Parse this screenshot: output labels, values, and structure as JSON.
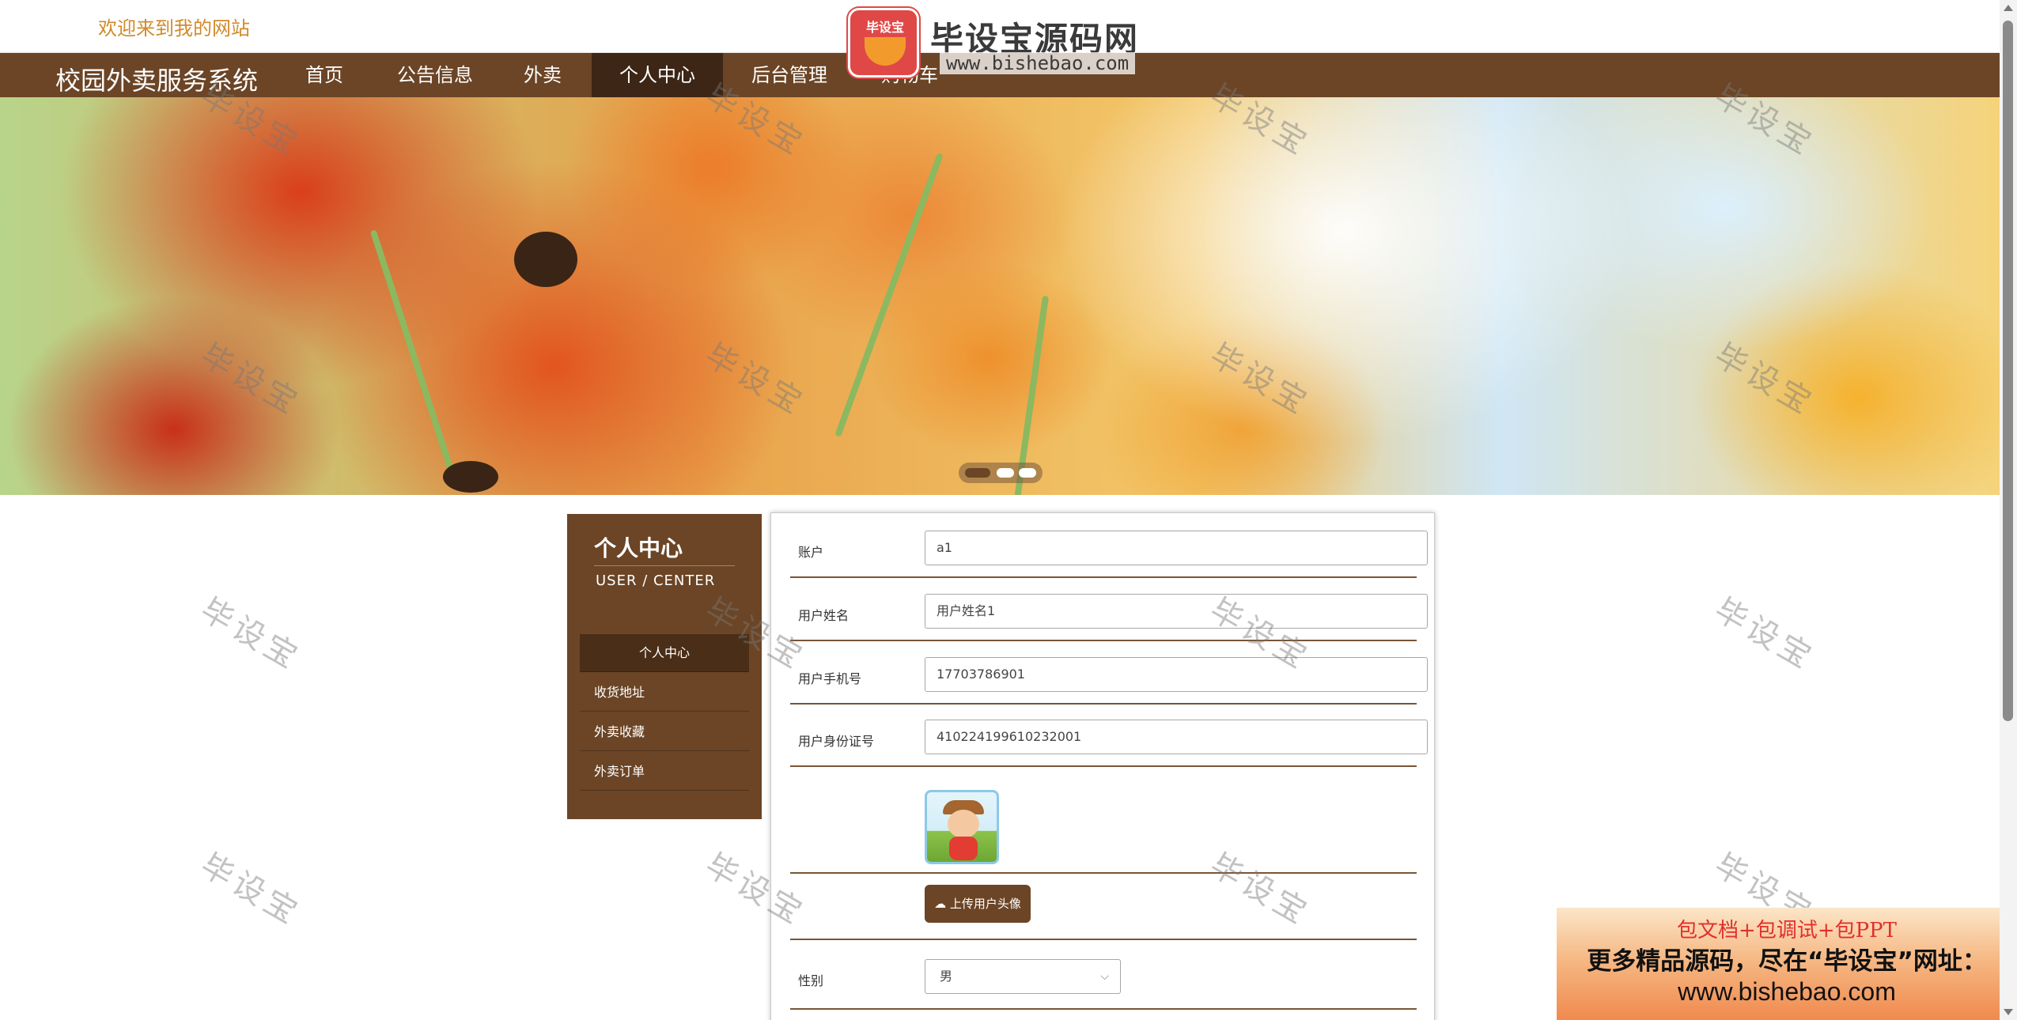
{
  "header": {
    "welcome": "欢迎来到我的网站"
  },
  "site_logo": {
    "emblem_text": "毕设宝",
    "name": "毕设宝源码网",
    "url": "www.bishebao.com"
  },
  "nav": {
    "brand": "校园外卖服务系统",
    "items": [
      {
        "label": "首页"
      },
      {
        "label": "公告信息"
      },
      {
        "label": "外卖"
      },
      {
        "label": "个人中心",
        "active": true
      },
      {
        "label": "后台管理"
      },
      {
        "label": "购物车"
      }
    ]
  },
  "banner": {
    "slide_count": 3,
    "active_slide": 1
  },
  "watermark": "毕设宝",
  "sidebar": {
    "title": "个人中心",
    "subtitle": "USER / CENTER",
    "items": [
      {
        "label": "个人中心",
        "active": true
      },
      {
        "label": "收货地址"
      },
      {
        "label": "外卖收藏"
      },
      {
        "label": "外卖订单"
      }
    ]
  },
  "form": {
    "account": {
      "label": "账户",
      "value": "a1"
    },
    "name": {
      "label": "用户姓名",
      "value": "用户姓名1"
    },
    "phone": {
      "label": "用户手机号",
      "value": "17703786901"
    },
    "id_card": {
      "label": "用户身份证号",
      "value": "410224199610232001"
    },
    "upload_button": "上传用户头像",
    "gender": {
      "label": "性别",
      "value": "男"
    }
  },
  "promo": {
    "line1": "包文档+包调试+包PPT",
    "line2": "更多精品源码，尽在“毕设宝”网址：",
    "line3": "www.bishebao.com"
  },
  "colors": {
    "primary": "#6b4526",
    "nav_active": "#3d2616",
    "welcome_text": "#d08a2a",
    "promo_red": "#e0302c"
  },
  "icons": {
    "upload": "cloud-upload-icon",
    "select": "chevron-down-icon"
  }
}
